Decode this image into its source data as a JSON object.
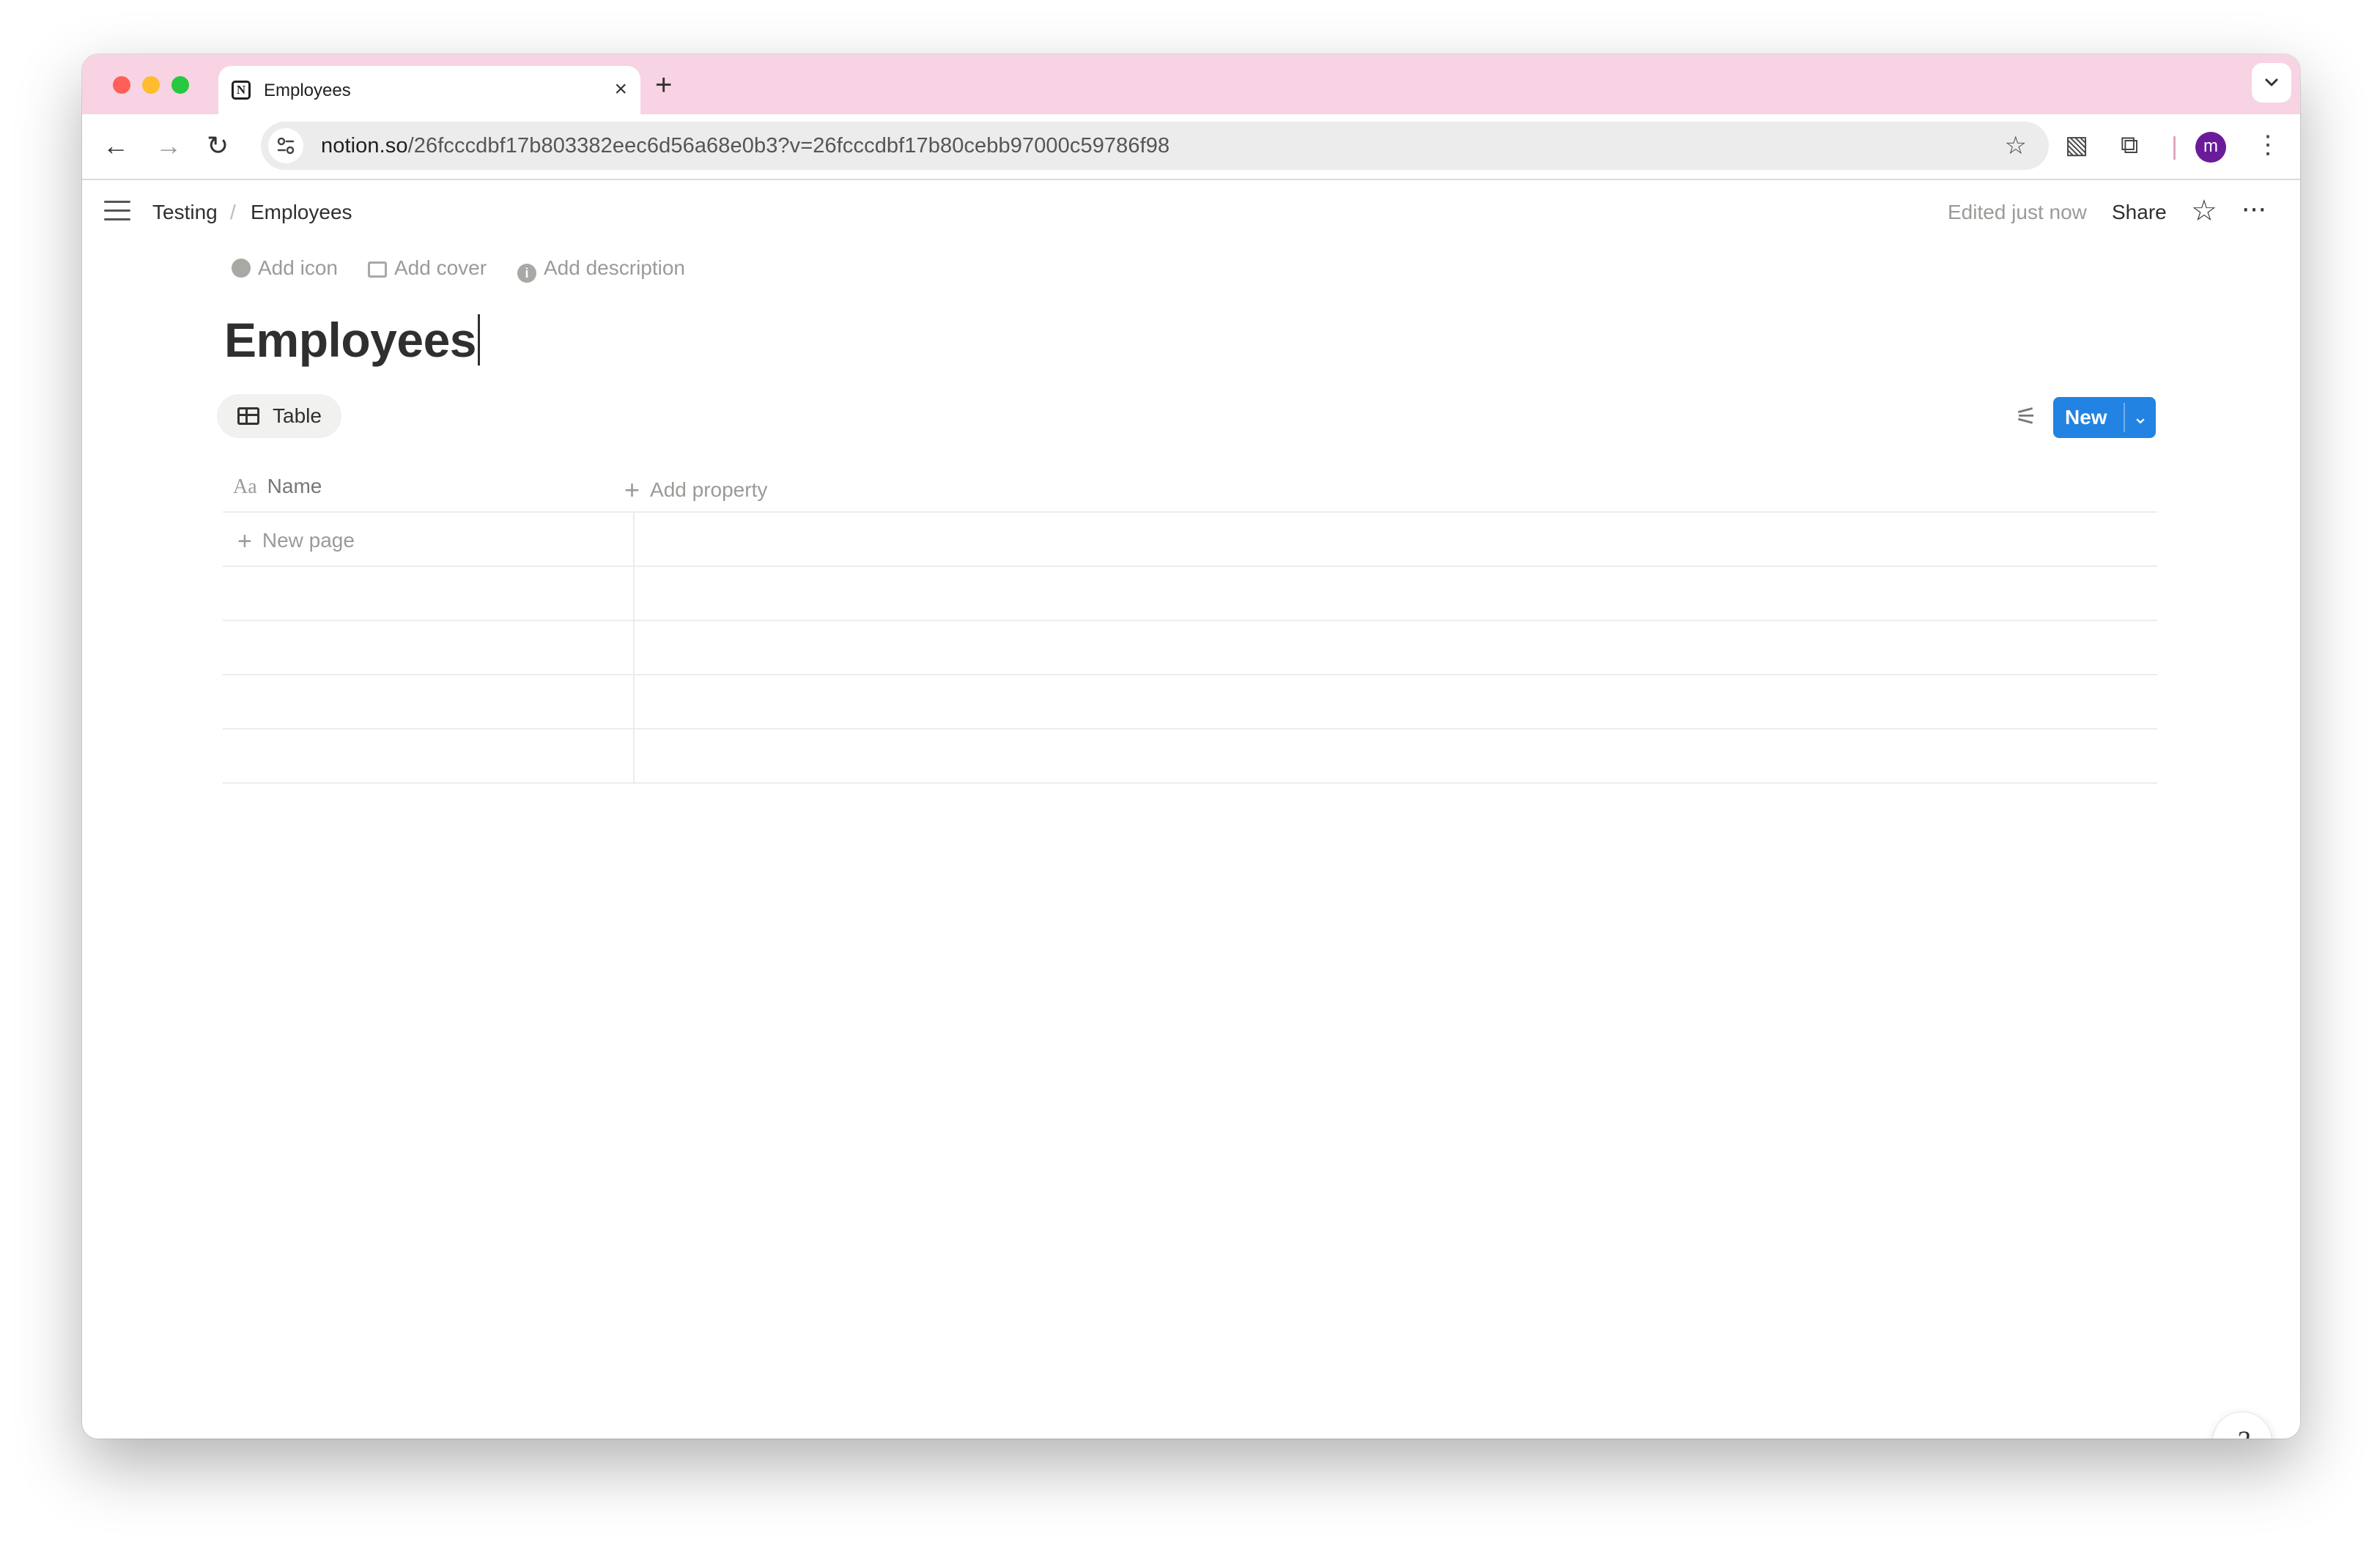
{
  "browser": {
    "tab": {
      "title": "Employees",
      "favicon": "notion-icon",
      "close": "×"
    },
    "new_tab": "+",
    "url_host": "notion.so",
    "url_path": "/26fcccdbf17b803382eec6d56a68e0b3?v=26fcccdbf17b80cebb97000c59786f98",
    "profile_initial": "m",
    "icons": {
      "back": "←",
      "forward": "→",
      "reload": "↻",
      "bookmark": "☆",
      "ext1": "▧",
      "extensions": "⧉",
      "menu": "⋮",
      "tab_search": "⌄"
    }
  },
  "notion": {
    "breadcrumb": [
      "Testing",
      "Employees"
    ],
    "breadcrumb_sep": "/",
    "edited": "Edited just now",
    "share": "Share",
    "favorite_icon": "☆",
    "more_icon": "···",
    "meta": {
      "add_icon": "Add icon",
      "add_cover": "Add cover",
      "add_description": "Add description"
    },
    "title": "Employees",
    "view_tab": "Table",
    "filter_icon": "⚟",
    "new_button": "New",
    "new_chevron": "⌄",
    "table": {
      "name_icon": "Aa",
      "name_header": "Name",
      "add_property": "Add property",
      "new_page": "New page",
      "plus": "+"
    },
    "help_icon": "?"
  },
  "colors": {
    "tabstrip": "#f7d3e3",
    "accent": "#2383e2",
    "profile": "#6a1b9a"
  }
}
